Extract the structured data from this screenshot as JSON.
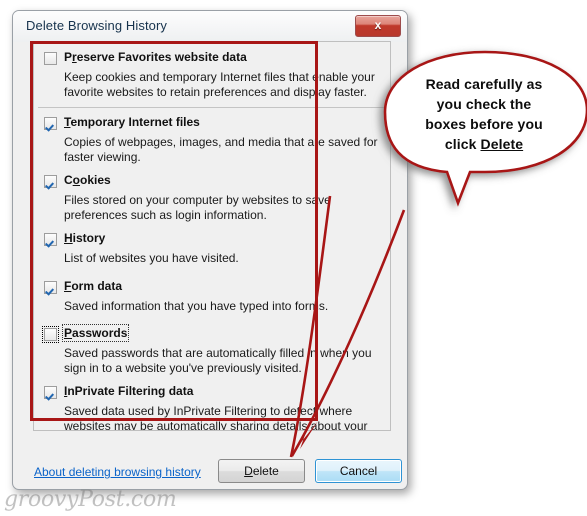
{
  "window": {
    "title": "Delete Browsing History",
    "close_icon": "close-x-icon",
    "close_glyph": "x"
  },
  "options": [
    {
      "id": "preserve-favorites",
      "label_before": "P",
      "accelerator": "r",
      "label_after": "eserve Favorites website data",
      "checked": false,
      "focused": false,
      "description": "Keep cookies and temporary Internet files that enable your favorite websites to retain preferences and display faster.",
      "separator_after": true
    },
    {
      "id": "temporary-internet-files",
      "label_before": "",
      "accelerator": "T",
      "label_after": "emporary Internet files",
      "checked": true,
      "focused": false,
      "description": "Copies of webpages, images, and media that are saved for faster viewing.",
      "separator_after": false
    },
    {
      "id": "cookies",
      "label_before": "C",
      "accelerator": "o",
      "label_after": "okies",
      "checked": true,
      "focused": false,
      "description": "Files stored on your computer by websites to save preferences such as login information.",
      "separator_after": false
    },
    {
      "id": "history",
      "label_before": "",
      "accelerator": "H",
      "label_after": "istory",
      "checked": true,
      "focused": false,
      "description": "List of websites you have visited.",
      "separator_after": false
    },
    {
      "id": "form-data",
      "label_before": "",
      "accelerator": "F",
      "label_after": "orm data",
      "checked": true,
      "focused": false,
      "description": "Saved information that you have typed into forms.",
      "separator_after": false
    },
    {
      "id": "passwords",
      "label_before": "",
      "accelerator": "P",
      "label_after": "asswords",
      "checked": false,
      "focused": true,
      "description": "Saved passwords that are automatically filled in when you sign in to a website you've previously visited.",
      "separator_after": false
    },
    {
      "id": "inprivate-filtering-data",
      "label_before": "",
      "accelerator": "I",
      "label_after": "nPrivate Filtering data",
      "checked": true,
      "focused": false,
      "description": "Saved data used by InPrivate Filtering to detect where websites may be automatically sharing details about your visit.",
      "separator_after": false
    }
  ],
  "footer": {
    "link_label": "About deleting browsing history",
    "delete_accelerator": "D",
    "delete_label_after": "elete",
    "cancel_label": "Cancel"
  },
  "annotation": {
    "callout_line1": "Read carefully as",
    "callout_line2": "you check the",
    "callout_line3": "boxes before you",
    "callout_line4_before": "click ",
    "callout_line4_emphasis": "Delete",
    "accent_color": "#a81616",
    "arrow_icon": "arrow-pointer-icon",
    "highlight_icon": "red-rectangle-highlight"
  },
  "watermark": {
    "text": "groovyPost.com"
  }
}
